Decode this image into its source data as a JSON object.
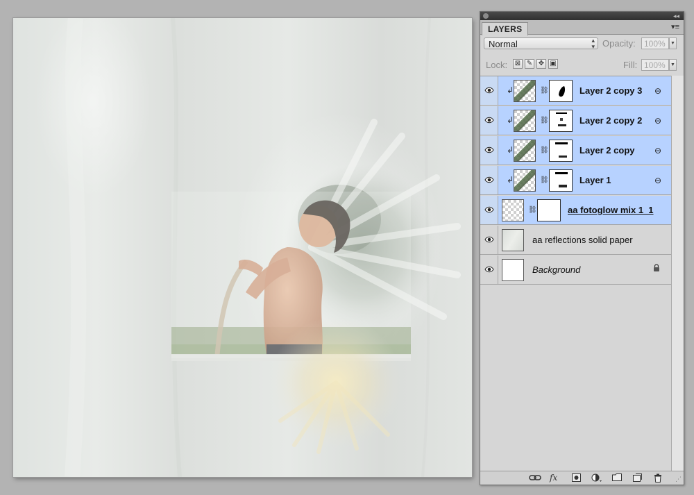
{
  "document": {
    "canvas_label": "canvas"
  },
  "panel": {
    "tab_label": "LAYERS",
    "blend_mode": "Normal",
    "opacity_label": "Opacity:",
    "opacity_value": "100%",
    "lock_label": "Lock:",
    "fill_label": "Fill:",
    "fill_value": "100%"
  },
  "layers": [
    {
      "name": "Layer 2 copy 3",
      "selected": true,
      "clipped": true,
      "thumb": "photo",
      "has_mask": true,
      "linked": true
    },
    {
      "name": "Layer 2 copy 2",
      "selected": true,
      "clipped": true,
      "thumb": "photo",
      "has_mask": true,
      "linked": true
    },
    {
      "name": "Layer 2 copy",
      "selected": true,
      "clipped": true,
      "thumb": "photo",
      "has_mask": true,
      "linked": true
    },
    {
      "name": "Layer 1",
      "selected": true,
      "clipped": true,
      "thumb": "photo",
      "has_mask": true,
      "linked": true
    },
    {
      "name": "aa fotoglow mix 1_1",
      "selected": true,
      "clipped": false,
      "thumb": "checker",
      "has_mask": true,
      "linked": false
    },
    {
      "name": "aa reflections solid paper",
      "selected": false,
      "clipped": false,
      "thumb": "paper",
      "has_mask": false,
      "linked": false
    },
    {
      "name": "Background",
      "selected": false,
      "clipped": false,
      "thumb": "white",
      "has_mask": false,
      "linked": false,
      "locked": true
    }
  ],
  "footer_icons": [
    "link-layers-icon",
    "fx-icon",
    "add-mask-icon",
    "adjustment-layer-icon",
    "new-group-icon",
    "new-layer-icon",
    "trash-icon"
  ],
  "colors": {
    "selection": "#b7d2ff",
    "panel_bg": "#d6d6d6",
    "workspace_bg": "#b3b3b3"
  }
}
